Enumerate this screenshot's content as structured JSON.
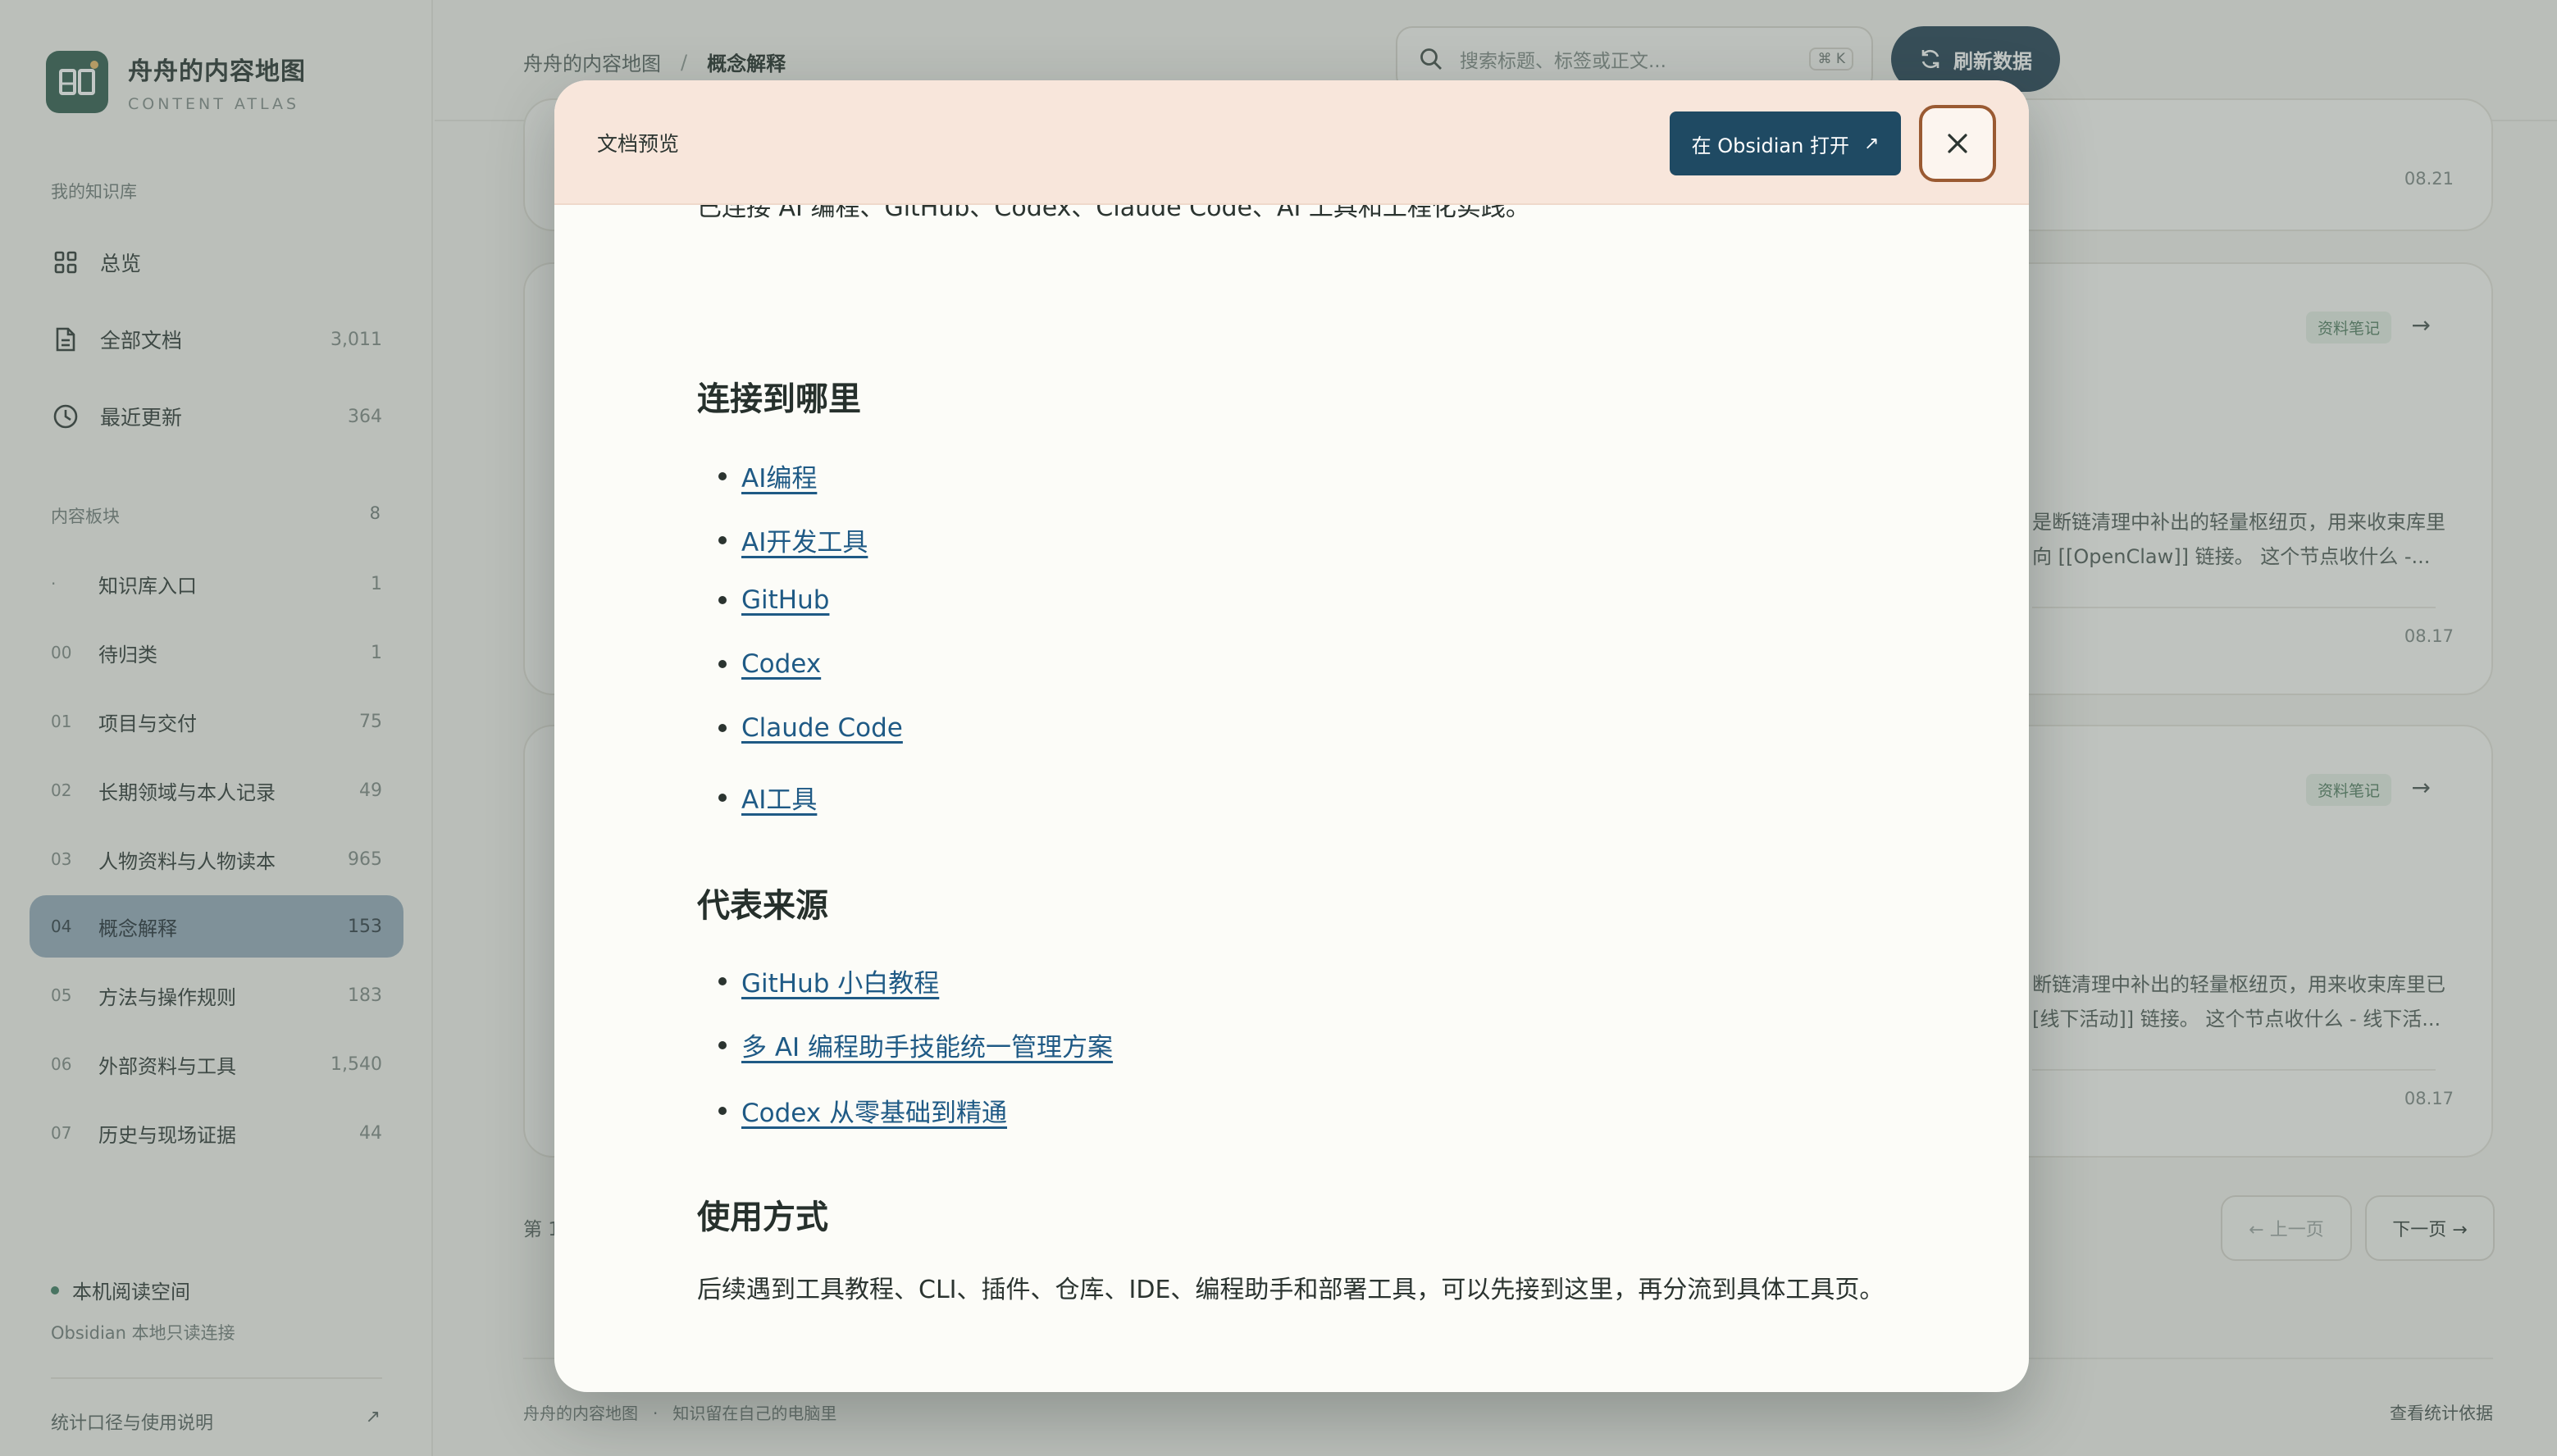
{
  "sidebar": {
    "brand_title": "舟舟的内容地图",
    "brand_sub": "CONTENT ATLAS",
    "library_label": "我的知识库",
    "main_nav": [
      {
        "label": "总览",
        "count": "",
        "icon": "grid-icon"
      },
      {
        "label": "全部文档",
        "count": "3,011",
        "icon": "document-icon"
      },
      {
        "label": "最近更新",
        "count": "364",
        "icon": "clock-icon"
      }
    ],
    "blocks_label": "内容板块",
    "blocks_count": "8",
    "blocks": [
      {
        "prefix": "·",
        "label": "知识库入口",
        "count": "1"
      },
      {
        "prefix": "00",
        "label": "待归类",
        "count": "1"
      },
      {
        "prefix": "01",
        "label": "项目与交付",
        "count": "75"
      },
      {
        "prefix": "02",
        "label": "长期领域与本人记录",
        "count": "49"
      },
      {
        "prefix": "03",
        "label": "人物资料与人物读本",
        "count": "965"
      },
      {
        "prefix": "04",
        "label": "概念解释",
        "count": "153"
      },
      {
        "prefix": "05",
        "label": "方法与操作规则",
        "count": "183"
      },
      {
        "prefix": "06",
        "label": "外部资料与工具",
        "count": "1,540"
      },
      {
        "prefix": "07",
        "label": "历史与现场证据",
        "count": "44"
      }
    ],
    "local_space": "本机阅读空间",
    "local_sub": "Obsidian 本地只读连接",
    "stats_link": "统计口径与使用说明",
    "stats_arrow": "↗"
  },
  "topbar": {
    "crumb_root": "舟舟的内容地图",
    "crumb_sep": "/",
    "crumb_current": "概念解释",
    "search_placeholder": "搜索标题、标签或正文...",
    "search_kbd": "⌘ K",
    "refresh_label": "刷新数据"
  },
  "cards": [
    {
      "tag": "",
      "excerpt1": "",
      "excerpt2": "",
      "date": "08.21"
    },
    {
      "tag": "资料笔记",
      "excerpt1": "是断链清理中补出的轻量枢纽页，用来收束库里",
      "excerpt2": "向 [[OpenClaw]] 链接。 这个节点收什么 -...",
      "date": "08.17"
    },
    {
      "tag": "资料笔记",
      "excerpt1": "断链清理中补出的轻量枢纽页，用来收束库里已",
      "excerpt2": "[线下活动]] 链接。 这个节点收什么 - 线下活...",
      "date": "08.17"
    }
  ],
  "pager": {
    "label": "第 1",
    "prev": "← 上一页",
    "next": "下一页 →"
  },
  "footer": {
    "left1": "舟舟的内容地图",
    "dot": "·",
    "left2": "知识留在自己的电脑里",
    "right": "查看统计依据"
  },
  "modal": {
    "title": "文档预览",
    "open_label": "在 Obsidian 打开",
    "open_arrow": "↗",
    "clipped_line": "已连接 AI 编程、GitHub、Codex、Claude Code、AI 工具和工程化实践。",
    "section1": "连接到哪里",
    "links1": [
      "AI编程",
      "AI开发工具",
      "GitHub",
      "Codex",
      "Claude Code",
      "AI工具"
    ],
    "section2": "代表来源",
    "links2": [
      "GitHub 小白教程",
      "多 AI 编程助手技能统一管理方案",
      "Codex 从零基础到精通"
    ],
    "section3": "使用方式",
    "usage": "后续遇到工具教程、CLI、插件、仓库、IDE、编程助手和部署工具，可以先接到这里，再分流到具体工具页。"
  }
}
